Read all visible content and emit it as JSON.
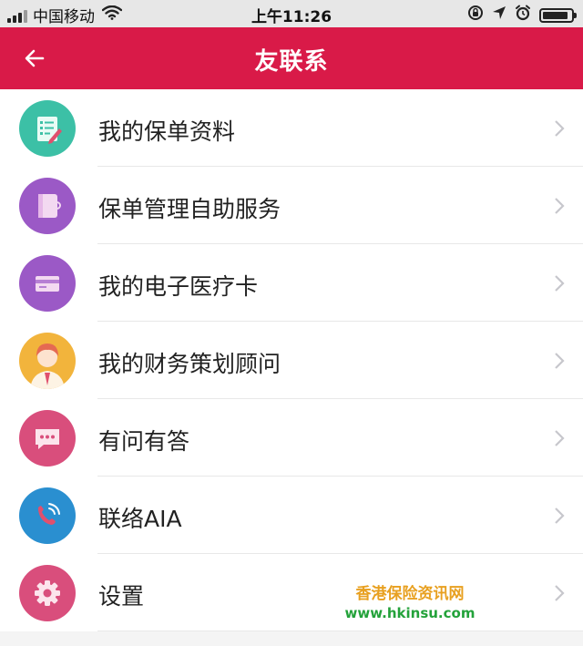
{
  "status_bar": {
    "carrier": "中国移动",
    "time": "上午11:26",
    "battery_level": 0.9
  },
  "nav": {
    "title": "友联系",
    "back_icon": "arrow-left-icon",
    "bar_color": "#d91a48"
  },
  "menu": {
    "items": [
      {
        "label": "我的保单资料",
        "icon": "policy-document-icon",
        "color": "#3cc0a6"
      },
      {
        "label": "保单管理自助服务",
        "icon": "notebook-icon",
        "color": "#9b59c6"
      },
      {
        "label": "我的电子医疗卡",
        "icon": "card-icon",
        "color": "#9b59c6"
      },
      {
        "label": "我的财务策划顾问",
        "icon": "advisor-avatar-icon",
        "color": "#f2b43c"
      },
      {
        "label": "有问有答",
        "icon": "chat-bubble-icon",
        "color": "#d94e7c"
      },
      {
        "label": "联络AIA",
        "icon": "phone-icon",
        "color": "#2a8fd0"
      },
      {
        "label": "设置",
        "icon": "gear-icon",
        "color": "#d94e7c"
      }
    ]
  },
  "watermark": {
    "name": "香港保险资讯网",
    "url": "www.hkinsu.com"
  }
}
